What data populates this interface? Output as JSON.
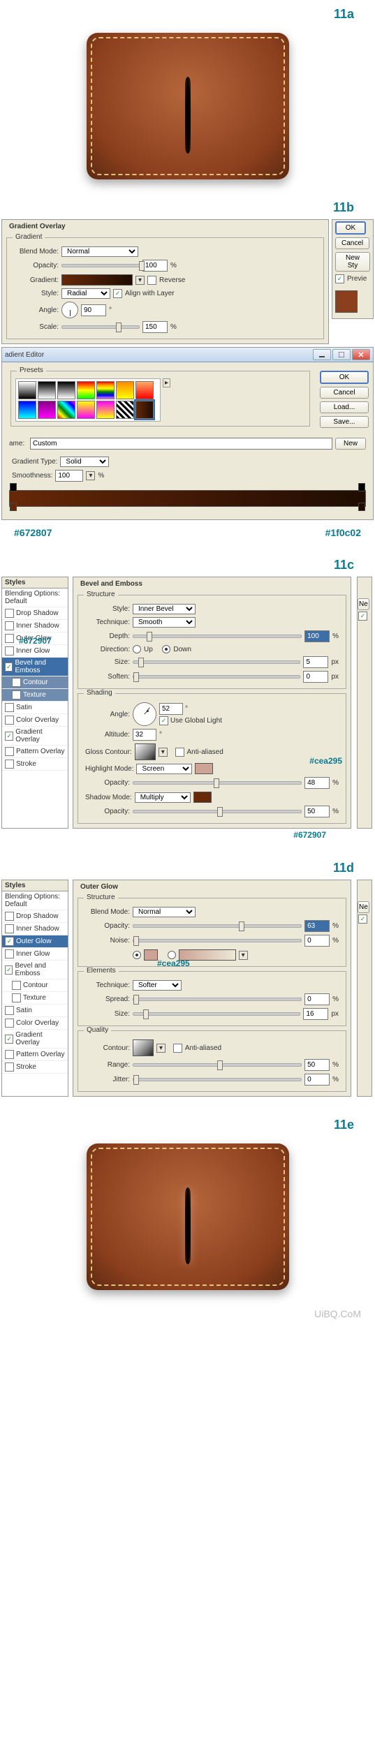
{
  "labels": {
    "s11a": "11a",
    "s11b": "11b",
    "s11c": "11c",
    "s11d": "11d",
    "s11e": "11e"
  },
  "hex": {
    "left": "#672807",
    "right": "#1f0c02",
    "bevel_inner_glow": "#672907",
    "bevel_highlight": "#cea295",
    "bevel_shadow_note": "#672907",
    "outer_glow_color": "#cea295"
  },
  "go": {
    "section": "Gradient Overlay",
    "sub": "Gradient",
    "blend_label": "Blend Mode:",
    "blend_value": "Normal",
    "opacity_label": "Opacity:",
    "opacity_value": "100",
    "percent": "%",
    "gradient_label": "Gradient:",
    "reverse": "Reverse",
    "style_label": "Style:",
    "style_value": "Radial",
    "align": "Align with Layer",
    "angle_label": "Angle:",
    "angle_value": "90",
    "angle_deg": "°",
    "scale_label": "Scale:",
    "scale_value": "150",
    "btn_ok": "OK",
    "btn_cancel": "Cancel",
    "btn_newstyle": "New Sty",
    "preview": "Previe"
  },
  "ge": {
    "title": "adient Editor",
    "presets": "Presets",
    "ok": "OK",
    "cancel": "Cancel",
    "load": "Load...",
    "save": "Save...",
    "name_label": "ame:",
    "name_value": "Custom",
    "new": "New",
    "type_label": "Gradient Type:",
    "type_value": "Solid",
    "smooth_label": "Smoothness:",
    "smooth_value": "100",
    "smooth_pct": "%"
  },
  "styles_list": {
    "header": "Styles",
    "blending": "Blending Options: Default",
    "items": [
      "Drop Shadow",
      "Inner Shadow",
      "Outer Glow",
      "Inner Glow",
      "Bevel and Emboss",
      "Contour",
      "Texture",
      "Satin",
      "Color Overlay",
      "Gradient Overlay",
      "Pattern Overlay",
      "Stroke"
    ]
  },
  "be": {
    "title": "Bevel and Emboss",
    "structure": "Structure",
    "style_l": "Style:",
    "style_v": "Inner Bevel",
    "tech_l": "Technique:",
    "tech_v": "Smooth",
    "depth_l": "Depth:",
    "depth_v": "100",
    "dir_l": "Direction:",
    "up": "Up",
    "down": "Down",
    "size_l": "Size:",
    "size_v": "5",
    "px": "px",
    "soften_l": "Soften:",
    "soften_v": "0",
    "shading": "Shading",
    "angle_l": "Angle:",
    "angle_v": "52",
    "global": "Use Global Light",
    "alt_l": "Altitude:",
    "alt_v": "32",
    "gloss_l": "Gloss Contour:",
    "aa": "Anti-aliased",
    "hmode_l": "Highlight Mode:",
    "hmode_v": "Screen",
    "opac_l": "Opacity:",
    "hopac_v": "48",
    "smode_l": "Shadow Mode:",
    "smode_v": "Multiply",
    "sopac_v": "50",
    "pct": "%",
    "deg": "°",
    "side_btn": "Ne"
  },
  "og": {
    "title": "Outer Glow",
    "structure": "Structure",
    "blend_l": "Blend Mode:",
    "blend_v": "Normal",
    "opac_l": "Opacity:",
    "opac_v": "63",
    "noise_l": "Noise:",
    "noise_v": "0",
    "elements": "Elements",
    "tech_l": "Technique:",
    "tech_v": "Softer",
    "spread_l": "Spread:",
    "spread_v": "0",
    "size_l": "Size:",
    "size_v": "16",
    "quality": "Quality",
    "contour_l": "Contour:",
    "aa": "Anti-aliased",
    "range_l": "Range:",
    "range_v": "50",
    "jitter_l": "Jitter:",
    "jitter_v": "0",
    "pct": "%",
    "px": "px",
    "side_btn": "Ne"
  },
  "watermark": "UiBQ.CoM"
}
